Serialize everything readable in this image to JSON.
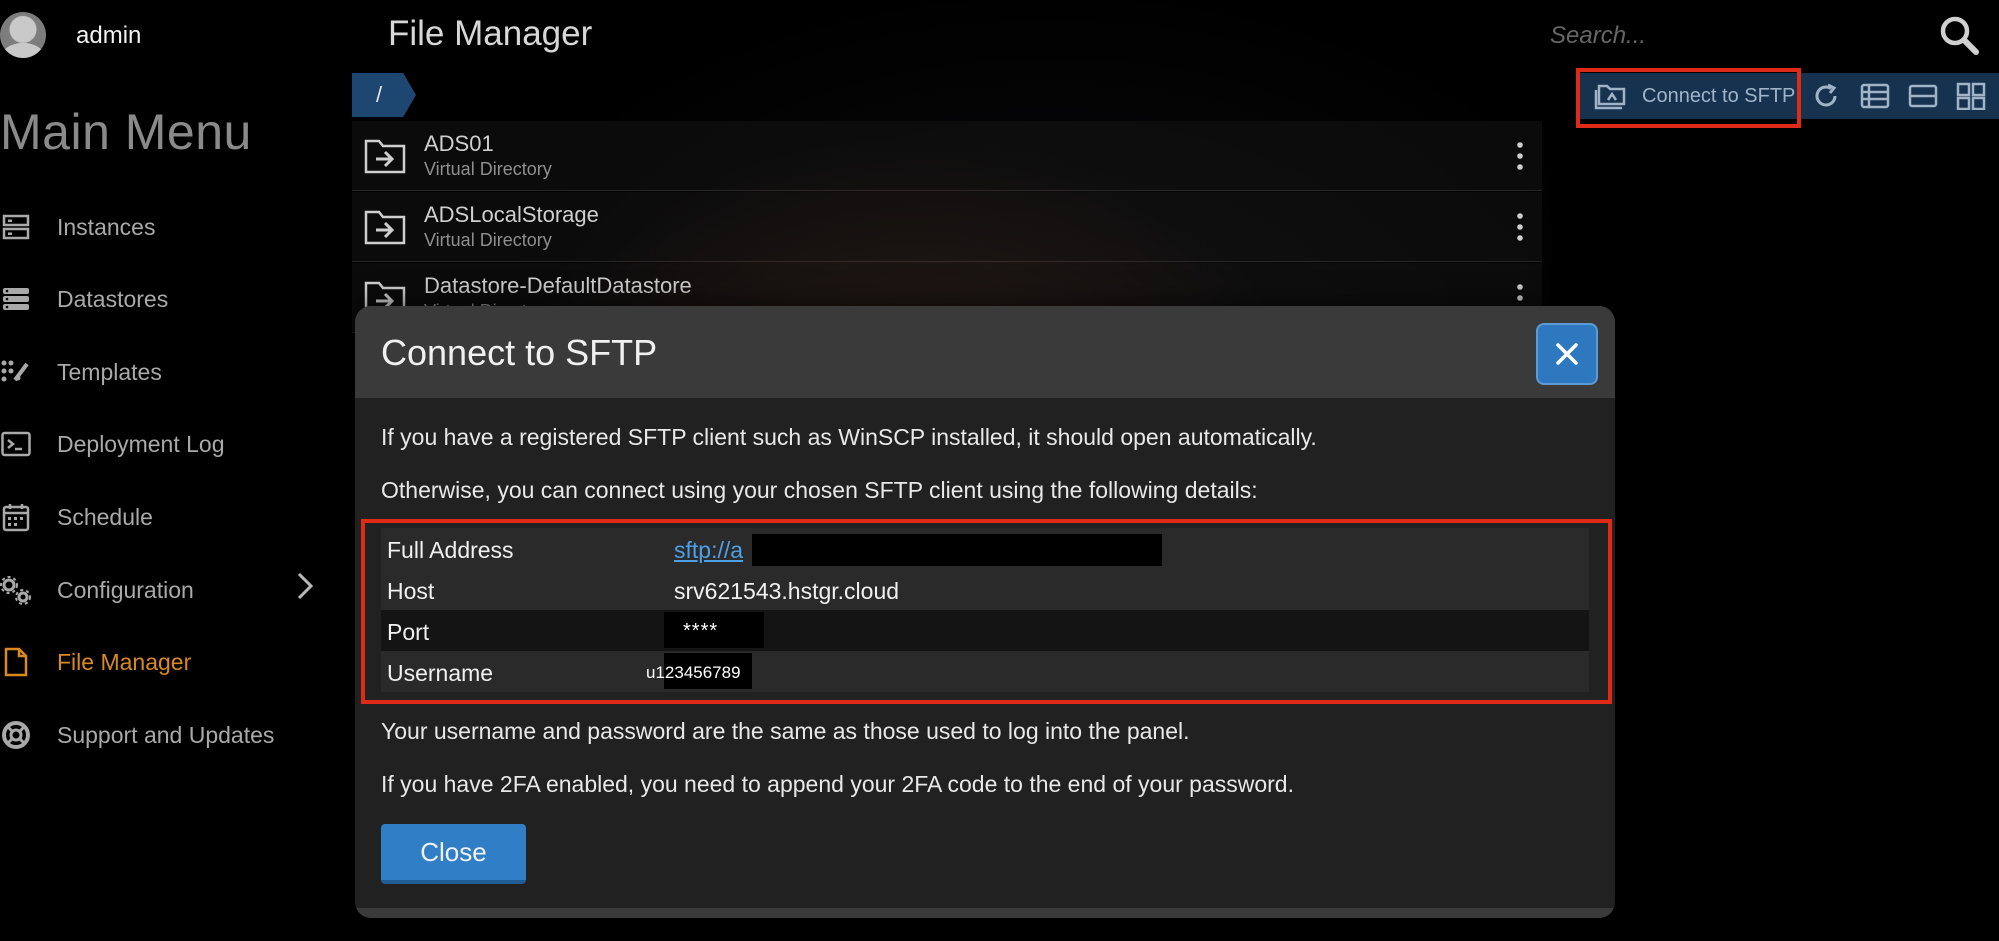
{
  "sidebar": {
    "username": "admin",
    "menu_title": "Main Menu",
    "items": [
      {
        "label": "Instances",
        "icon": "server-icon"
      },
      {
        "label": "Datastores",
        "icon": "datastore-icon"
      },
      {
        "label": "Templates",
        "icon": "templates-icon"
      },
      {
        "label": "Deployment Log",
        "icon": "terminal-icon"
      },
      {
        "label": "Schedule",
        "icon": "calendar-icon"
      },
      {
        "label": "Configuration",
        "icon": "gears-icon"
      },
      {
        "label": "File Manager",
        "icon": "file-icon"
      },
      {
        "label": "Support and Updates",
        "icon": "lifebuoy-icon"
      }
    ]
  },
  "header": {
    "title": "File Manager",
    "search_placeholder": "Search..."
  },
  "toolbar": {
    "sftp_label": "Connect to SFTP"
  },
  "breadcrumb": "/",
  "files": [
    {
      "name": "ADS01",
      "type": "Virtual Directory"
    },
    {
      "name": "ADSLocalStorage",
      "type": "Virtual Directory"
    },
    {
      "name": "Datastore-DefaultDatastore",
      "type": "Virtual Directory"
    }
  ],
  "modal": {
    "title": "Connect to SFTP",
    "intro": "If you have a registered SFTP client such as WinSCP installed, it should open automatically.",
    "otherwise": "Otherwise, you can connect using your chosen SFTP client using the following details:",
    "details": [
      {
        "label": "Full Address",
        "value": "sftp://a"
      },
      {
        "label": "Host",
        "value": "srv621543.hstgr.cloud"
      },
      {
        "label": "Port",
        "value": "****"
      },
      {
        "label": "Username",
        "value": "u123456789"
      }
    ],
    "note1": "Your username and password are the same as those used to log into the panel.",
    "note2": "If you have 2FA enabled, you need to append your 2FA code to the end of your password.",
    "close_label": "Close"
  },
  "colors": {
    "accent_active": "#d98a1f",
    "primary_button": "#2f7ec6",
    "highlight": "#e02a18",
    "toolbar_bg": "#16324f"
  }
}
